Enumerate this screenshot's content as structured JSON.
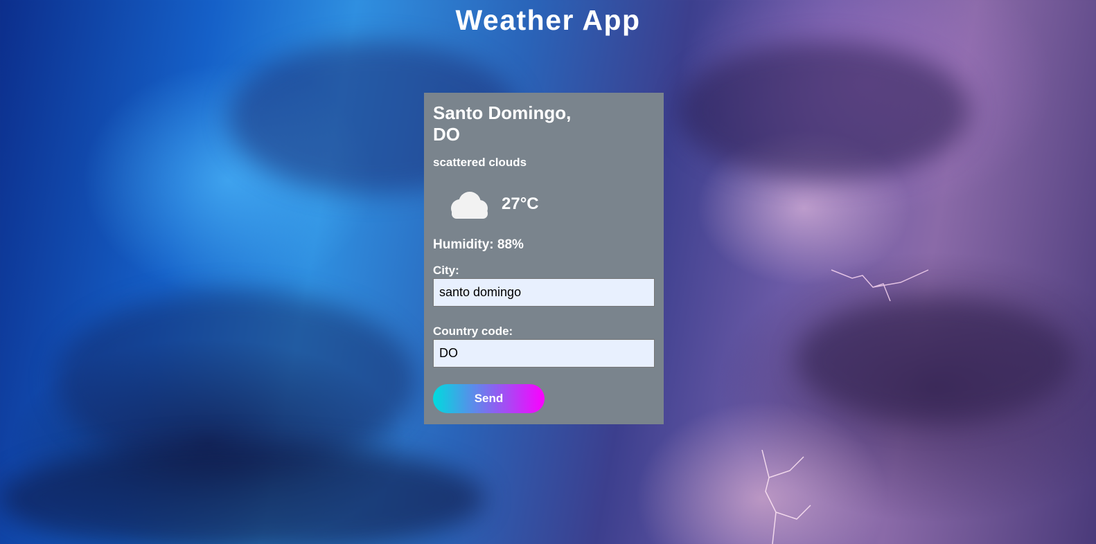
{
  "header": {
    "title": "Weather App"
  },
  "weather": {
    "location": "Santo Domingo, DO",
    "description": "scattered clouds",
    "icon": "cloud-icon",
    "temperature": "27°C",
    "humidity": "Humidity: 88%"
  },
  "form": {
    "city_label": "City:",
    "city_value": "santo domingo",
    "country_label": "Country code:",
    "country_value": "DO",
    "send_label": "Send"
  },
  "colors": {
    "card_background": "#7a848d",
    "button_gradient_start": "#00dbde",
    "button_gradient_end": "#fc00ff",
    "input_background": "#e8f0fe"
  }
}
